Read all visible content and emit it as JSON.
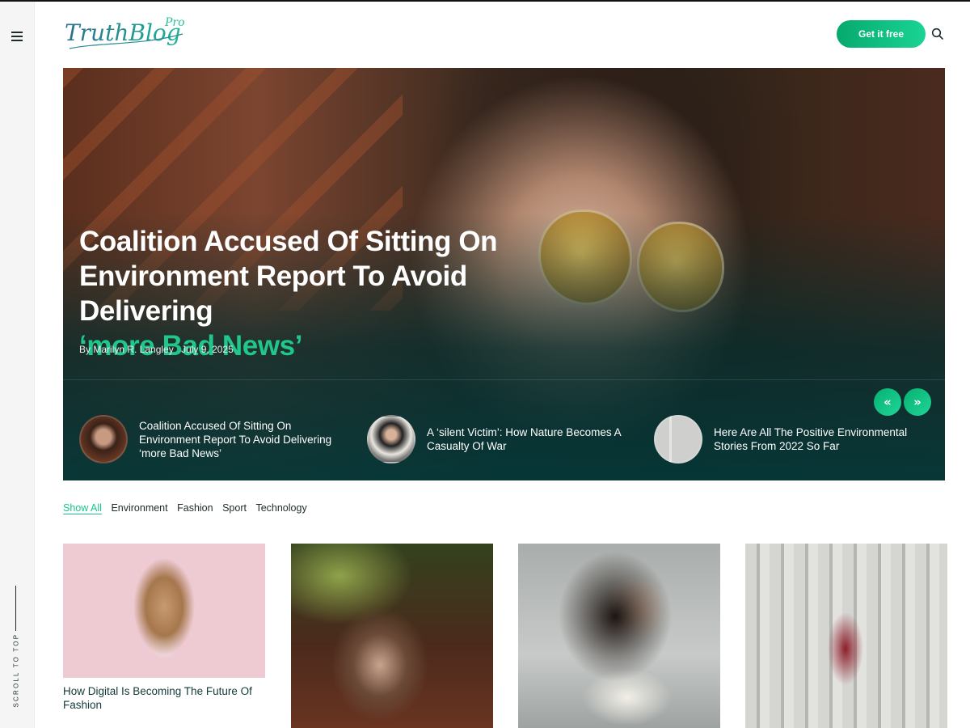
{
  "header": {
    "logo_text": "TruthBlog",
    "logo_badge": "Pro",
    "cta_label": "Get it free"
  },
  "sidebar": {
    "scroll_label": "SCROLL TO TOP"
  },
  "hero": {
    "title_main": "Coalition Accused Of Sitting On Environment Report To Avoid Delivering",
    "title_highlight": "‘more Bad News’",
    "author": "By Marilyn R. Langley",
    "date": "July 9, 2025",
    "prev_label": "«",
    "next_label": "»",
    "thumbs": [
      {
        "title": "Coalition Accused Of Sitting On Environment Report To Avoid Delivering ‘more Bad News’"
      },
      {
        "title": "A ‘silent Victim’: How Nature Becomes A Casualty Of War"
      },
      {
        "title": "Here Are All The Positive Environmental Stories From 2022 So Far"
      }
    ]
  },
  "filters": [
    "Show All",
    "Environment",
    "Fashion",
    "Sport",
    "Technology"
  ],
  "cards": [
    {
      "title": "How Digital Is Becoming The Future Of Fashion"
    },
    {
      "title": ""
    },
    {
      "title": ""
    },
    {
      "title": ""
    }
  ],
  "colors": {
    "accent": "#18c48a",
    "hero_overlay": "#054a4a",
    "heading": "#123a37"
  },
  "icons": [
    "menu-icon",
    "search-icon",
    "chevron-double-left-icon",
    "chevron-double-right-icon"
  ]
}
